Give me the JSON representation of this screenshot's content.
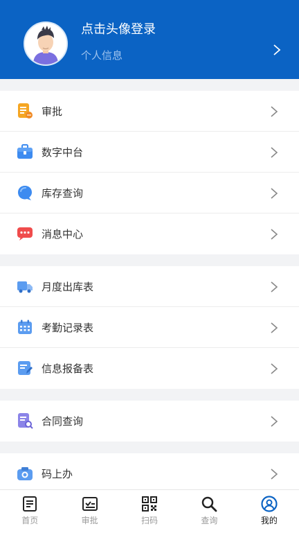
{
  "header": {
    "login_prompt": "点击头像登录",
    "profile_link": "个人信息",
    "background_color": "#0b63c4"
  },
  "menu_groups": [
    {
      "items": [
        {
          "label": "审批",
          "icon": "approval-doc-icon",
          "color": "#f5a623"
        },
        {
          "label": "数字中台",
          "icon": "briefcase-icon",
          "color": "#3d8bf0"
        },
        {
          "label": "库存查询",
          "icon": "chat-bubble-icon",
          "color": "#3d8bf0"
        },
        {
          "label": "消息中心",
          "icon": "message-icon",
          "color": "#f04c4c"
        }
      ]
    },
    {
      "items": [
        {
          "label": "月度出库表",
          "icon": "truck-icon",
          "color": "#5b9cf0"
        },
        {
          "label": "考勤记录表",
          "icon": "calendar-icon",
          "color": "#5b9cf0"
        },
        {
          "label": "信息报备表",
          "icon": "edit-form-icon",
          "color": "#5b9cf0"
        }
      ]
    },
    {
      "items": [
        {
          "label": "合同查询",
          "icon": "contract-search-icon",
          "color": "#8b84e8"
        }
      ]
    },
    {
      "items": [
        {
          "label": "码上办",
          "icon": "camera-icon",
          "color": "#5b9cf0"
        }
      ]
    }
  ],
  "tabbar": {
    "tabs": [
      {
        "label": "首页",
        "icon": "home-doc-icon",
        "active": false
      },
      {
        "label": "审批",
        "icon": "check-list-icon",
        "active": false
      },
      {
        "label": "扫码",
        "icon": "qr-code-icon",
        "active": false
      },
      {
        "label": "查询",
        "icon": "search-icon",
        "active": false
      },
      {
        "label": "我的",
        "icon": "user-circle-icon",
        "active": true
      }
    ]
  }
}
